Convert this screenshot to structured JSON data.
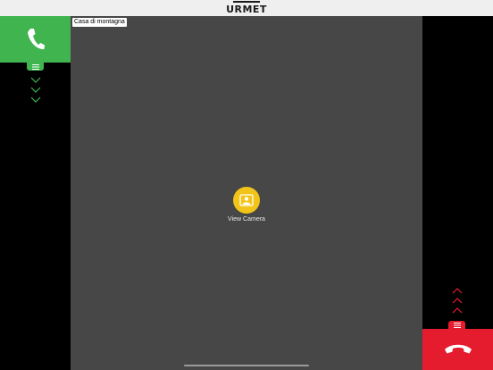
{
  "header": {
    "logo_text": "URMET"
  },
  "video": {
    "location_label": "Casa di montagna",
    "view_camera_label": "View Camera"
  },
  "left_panel": {
    "answer_icon": "phone-icon",
    "menu_icon": "menu-icon",
    "chevron_icon": "chevron-down-icon"
  },
  "right_panel": {
    "hangup_icon": "phone-hangup-icon",
    "menu_icon": "menu-icon",
    "chevron_icon": "chevron-up-icon"
  },
  "colors": {
    "answer_green": "#3fb44f",
    "hangup_red": "#e41c2d",
    "camera_yellow": "#f2c419",
    "video_gray": "#474747",
    "topbar_gray": "#efefef"
  }
}
